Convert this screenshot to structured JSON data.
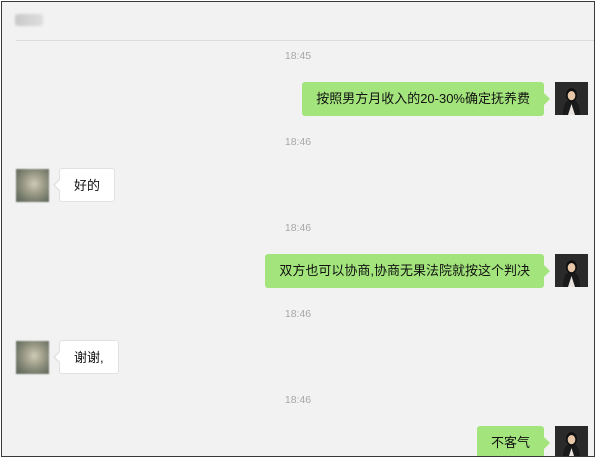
{
  "chat": {
    "title": "",
    "messages": [
      {
        "time": "18:45",
        "from": "me",
        "text": "按照男方月收入的20-30%确定抚养费"
      },
      {
        "time": "18:46",
        "from": "peer",
        "text": "好的"
      },
      {
        "time": "18:46",
        "from": "me",
        "text": "双方也可以协商,协商无果法院就按这个判决"
      },
      {
        "time": "18:46",
        "from": "peer",
        "text": "谢谢,"
      },
      {
        "time": "18:46",
        "from": "me",
        "text": "不客气"
      }
    ]
  },
  "colors": {
    "window_bg": "#f2f2f2",
    "my_bubble": "#a3e57c",
    "peer_bubble": "#ffffff",
    "timestamp": "#a7a7a7",
    "border": "#3a3a3a"
  },
  "icons": {
    "my_avatar": "woman-portrait-avatar",
    "peer_avatar": "blurred-avatar"
  }
}
